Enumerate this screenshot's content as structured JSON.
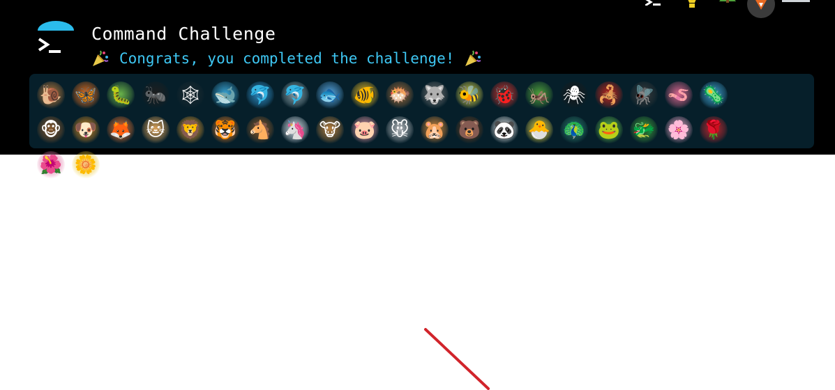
{
  "app": {
    "title": "Command Challenge",
    "congrats_message": "Congrats, you completed the challenge!"
  },
  "colors": {
    "header_bg": "#000000",
    "panel_bg": "#061f2a",
    "accent_cyan": "#3ec7f3",
    "annotation_red": "#d1242b"
  },
  "top_icons": [
    "terminal-icon",
    "lightbulb-icon",
    "tree-icon",
    "avatar",
    "keyboard-icon"
  ],
  "animals": [
    {
      "name": "snail-icon",
      "glyph": "🐌",
      "color": "#b87a3c"
    },
    {
      "name": "butterfly-icon",
      "glyph": "🦋",
      "color": "#e06d1f"
    },
    {
      "name": "caterpillar-icon",
      "glyph": "🐛",
      "color": "#6ab34a"
    },
    {
      "name": "ant-icon",
      "glyph": "🐜",
      "color": "#1f1f1f"
    },
    {
      "name": "spider-web-icon",
      "glyph": "🕸",
      "color": "#1c2a30"
    },
    {
      "name": "whale-icon",
      "glyph": "🐋",
      "color": "#3ba7d8"
    },
    {
      "name": "dolphin-icon",
      "glyph": "🐬",
      "color": "#2e8fc9"
    },
    {
      "name": "dolphin-gray-icon",
      "glyph": "🐬",
      "color": "#8aa0a8"
    },
    {
      "name": "fish-icon",
      "glyph": "🐟",
      "color": "#58a7e2"
    },
    {
      "name": "tropical-fish-icon",
      "glyph": "🐠",
      "color": "#e8b923"
    },
    {
      "name": "blowfish-icon",
      "glyph": "🐡",
      "color": "#9c6a3a"
    },
    {
      "name": "wolf-icon",
      "glyph": "🐺",
      "color": "#6b6b6b"
    },
    {
      "name": "bee-icon",
      "glyph": "🐝",
      "color": "#d8d34a"
    },
    {
      "name": "ladybug-icon",
      "glyph": "🐞",
      "color": "#d4302a"
    },
    {
      "name": "cricket-icon",
      "glyph": "🦗",
      "color": "#4fa03a"
    },
    {
      "name": "spider-icon",
      "glyph": "🕷",
      "color": "#1a1a1a"
    },
    {
      "name": "scorpion-icon",
      "glyph": "🦂",
      "color": "#c2261e"
    },
    {
      "name": "fly-icon",
      "glyph": "🪰",
      "color": "#3a3a3a"
    },
    {
      "name": "worm-icon",
      "glyph": "🪱",
      "color": "#d9668e"
    },
    {
      "name": "microbe-icon",
      "glyph": "🦠",
      "color": "#3fa0cf"
    },
    {
      "name": "monkey-icon",
      "glyph": "🐵",
      "color": "#8a5a2e"
    },
    {
      "name": "dog-icon",
      "glyph": "🐶",
      "color": "#d08a26"
    },
    {
      "name": "fox-icon",
      "glyph": "🦊",
      "color": "#e07030"
    },
    {
      "name": "cat-icon",
      "glyph": "🐱",
      "color": "#e0a55a"
    },
    {
      "name": "lion-icon",
      "glyph": "🦁",
      "color": "#d8962e"
    },
    {
      "name": "tiger-icon",
      "glyph": "🐯",
      "color": "#e07a24"
    },
    {
      "name": "horse-icon",
      "glyph": "🐴",
      "color": "#8c5a2b"
    },
    {
      "name": "unicorn-icon",
      "glyph": "🦄",
      "color": "#dfe8f0"
    },
    {
      "name": "cow-icon",
      "glyph": "🐮",
      "color": "#b8803f"
    },
    {
      "name": "pig-icon",
      "glyph": "🐷",
      "color": "#e89aa8"
    },
    {
      "name": "mouse-icon",
      "glyph": "🐭",
      "color": "#b0b4b8"
    },
    {
      "name": "hamster-icon",
      "glyph": "🐹",
      "color": "#d68a3c"
    },
    {
      "name": "bear-icon",
      "glyph": "🐻",
      "color": "#6a3f1f"
    },
    {
      "name": "panda-icon",
      "glyph": "🐼",
      "color": "#e8e8e8"
    },
    {
      "name": "hatching-chick-icon",
      "glyph": "🐣",
      "color": "#ecd94a"
    },
    {
      "name": "peacock-icon",
      "glyph": "🦚",
      "color": "#2a7a6a"
    },
    {
      "name": "frog-icon",
      "glyph": "🐸",
      "color": "#5cb84a"
    },
    {
      "name": "dragon-icon",
      "glyph": "🐲",
      "color": "#3f9b3a"
    },
    {
      "name": "cherry-blossom-icon",
      "glyph": "🌸",
      "color": "#e6a3c3"
    },
    {
      "name": "rose-icon",
      "glyph": "🌹",
      "color": "#c4282e"
    },
    {
      "name": "hibiscus-icon",
      "glyph": "🌺",
      "color": "#e07aa8"
    },
    {
      "name": "sunflower-icon",
      "glyph": "🌼",
      "color": "#ecc936"
    }
  ]
}
